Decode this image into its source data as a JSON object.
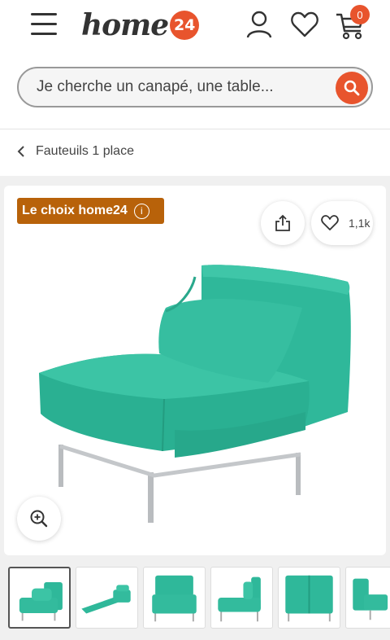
{
  "header": {
    "logo_text": "home",
    "logo_badge": "24",
    "cart_count": "0"
  },
  "search": {
    "placeholder": "Je cherche un canapé, une table..."
  },
  "breadcrumb": {
    "label": "Fauteuils 1 place"
  },
  "product": {
    "badge_label": "Le choix home24",
    "badge_info": "i",
    "wishlist_count": "1,1k",
    "colors": {
      "accent": "#e8542d",
      "badge": "#b8620a",
      "sofa": "#2fb89a"
    }
  },
  "icons": [
    "menu-icon",
    "user-icon",
    "heart-icon",
    "cart-icon",
    "search-icon",
    "chevron-left-icon",
    "info-icon",
    "share-icon",
    "zoom-in-icon"
  ]
}
